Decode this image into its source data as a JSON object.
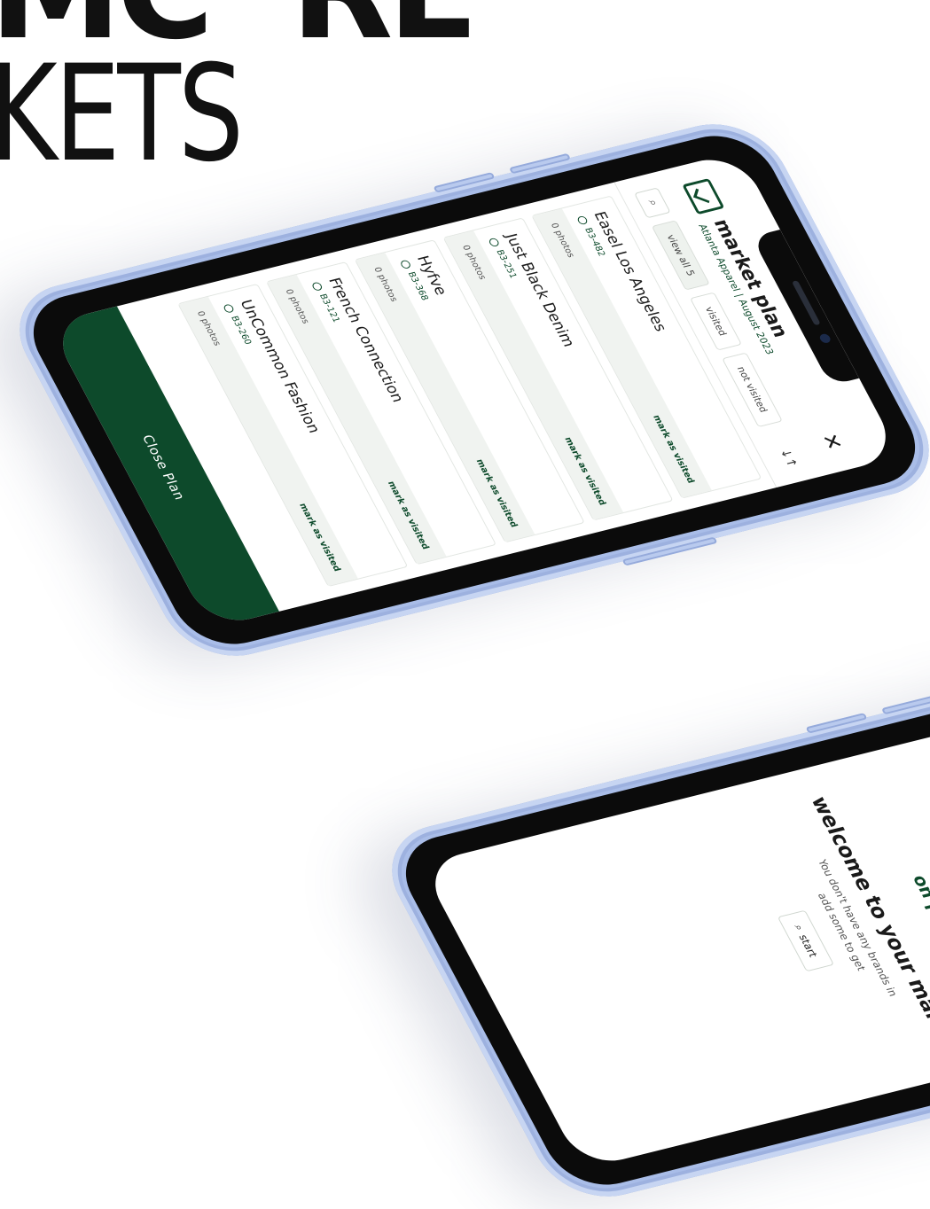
{
  "headline": {
    "line1": "MC",
    "line1b": "RE",
    "line2": "KETS"
  },
  "plan": {
    "title": "market plan",
    "subtitle": "Atlanta Apparel | August 2023"
  },
  "filters": {
    "view_all": "view all 5",
    "visited": "visited",
    "not_visited": "not visited"
  },
  "brands": [
    {
      "name": "Easel Los Angeles",
      "booth": "B3-482",
      "photos": "0 photos",
      "action": "mark as visited"
    },
    {
      "name": "Just Black Denim",
      "booth": "B3-251",
      "photos": "0 photos",
      "action": "mark as visited"
    },
    {
      "name": "Hyfve",
      "booth": "B3-368",
      "photos": "0 photos",
      "action": "mark as visited"
    },
    {
      "name": "French Connection",
      "booth": "B3-121",
      "photos": "0 photos",
      "action": "mark as visited"
    },
    {
      "name": "UnCommon Fashion",
      "booth": "B3-260",
      "photos": "0 photos",
      "action": "mark as visited"
    }
  ],
  "close_plan": "Close Plan",
  "empty": {
    "status": "on plan",
    "heading": "welcome to your marke",
    "body_line1": "You don't have any brands in",
    "body_line2": "add some to get",
    "start_label": "start"
  },
  "colors": {
    "brand_green": "#0d4a2b",
    "phone_frame": "#a9bde8"
  }
}
